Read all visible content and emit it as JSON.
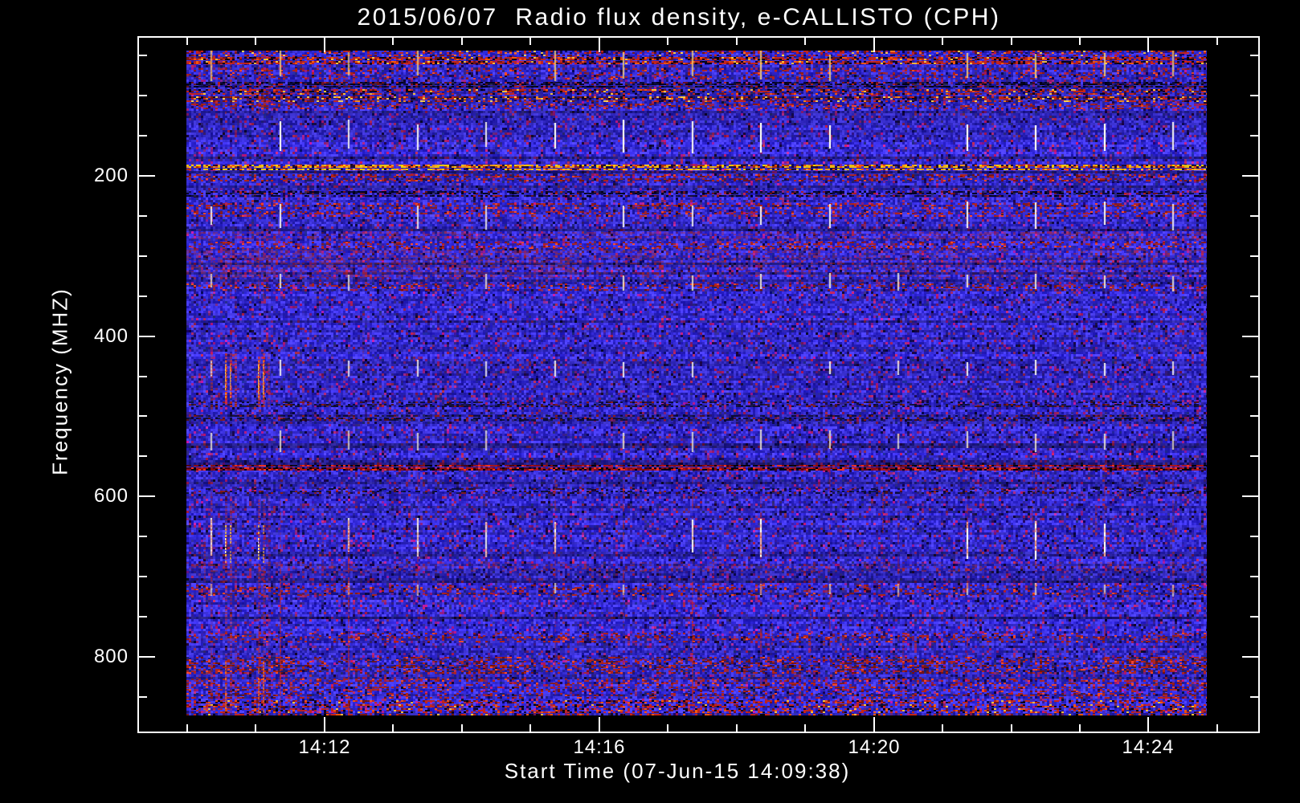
{
  "colors": {
    "background": "#000000",
    "text": "#ffffff",
    "frame": "#ffffff"
  },
  "chart_data": {
    "type": "heatmap",
    "variant": "radio-spectrogram",
    "title": "2015/06/07  Radio flux density, e-CALLISTO (CPH)",
    "xlabel": "Start Time (07-Jun-15 14:09:38)",
    "ylabel": "Frequency (MHZ)",
    "instrument": "e-CALLISTO (CPH)",
    "date": "2015/06/07",
    "start_time": "14:09:38",
    "x_axis": {
      "unit": "minutes-since-14:00",
      "range": [
        9.28,
        25.62
      ],
      "major_ticks": [
        {
          "value": 12,
          "label": "14:12"
        },
        {
          "value": 16,
          "label": "14:16"
        },
        {
          "value": 20,
          "label": "14:20"
        },
        {
          "value": 24,
          "label": "14:24"
        }
      ],
      "minor_tick_interval": 1
    },
    "y_axis": {
      "unit": "MHz",
      "range": [
        26,
        895
      ],
      "inverted": true,
      "major_ticks": [
        {
          "value": 200,
          "label": "200"
        },
        {
          "value": 400,
          "label": "400"
        },
        {
          "value": 600,
          "label": "600"
        },
        {
          "value": 800,
          "label": "800"
        }
      ],
      "minor_tick_interval": 50
    },
    "data_extent": {
      "time": [
        9.99,
        24.85
      ],
      "freq": [
        44,
        873
      ]
    },
    "background_noise": {
      "base_blue_low": "#1a1aa8",
      "base_blue_high": "#4a4aff",
      "dark_cell": "#05052e",
      "red_speckle": "#a02828",
      "dark_prob": 0.05,
      "red_speckle_prob": 0.08,
      "mid_blue_prob": 0.12
    },
    "palettes": {
      "rfi_mix": [
        [
          "#cc2410",
          0.3
        ],
        [
          "#ff7a1e",
          0.08
        ],
        [
          "#2a2ae0",
          0.25
        ],
        [
          "#0a0a50",
          0.17
        ],
        [
          "#ffd24a",
          0.05
        ],
        [
          "#7a1408",
          0.15
        ]
      ],
      "rfi_red": [
        [
          "#cc2410",
          0.4
        ],
        [
          "#ff5a00",
          0.12
        ],
        [
          "#ffc832",
          0.06
        ],
        [
          "#7a1408",
          0.18
        ],
        [
          "#0a0014",
          0.14
        ],
        [
          "#000000",
          0.1
        ]
      ],
      "rfi_yellow": [
        [
          "#cc2410",
          0.3
        ],
        [
          "#ff8c14",
          0.16
        ],
        [
          "#ffd24a",
          0.12
        ],
        [
          "#7a1408",
          0.2
        ],
        [
          "#140014",
          0.22
        ]
      ],
      "yellow_line": [
        [
          "#ffd200",
          0.3
        ],
        [
          "#ffa014",
          0.22
        ],
        [
          "#ff5000",
          0.14
        ],
        [
          "#b43200",
          0.12
        ],
        [
          "#1e0a28",
          0.22
        ]
      ],
      "dark": [
        [
          "#000010",
          0.45
        ],
        [
          "#0c0c3a",
          0.25
        ],
        [
          "#6e1010",
          0.12
        ],
        [
          "#b41e14",
          0.1
        ],
        [
          "#28284a",
          0.08
        ]
      ],
      "dark_faint": [
        [
          "#0a0a2e",
          0.5
        ],
        [
          "#14143c",
          0.2
        ],
        [
          "#501010",
          0.15
        ],
        [
          "#8c1a10",
          0.15
        ]
      ],
      "strong_line": [
        [
          "#8c0a0a",
          0.3
        ],
        [
          "#b41410",
          0.2
        ],
        [
          "#000000",
          0.28
        ],
        [
          "#ff3214",
          0.12
        ],
        [
          "#500000",
          0.1
        ]
      ],
      "red_sparse": [
        [
          "#b42314",
          0.55
        ],
        [
          "#8c1a0f",
          0.3
        ],
        [
          "#ff4b23",
          0.15
        ]
      ],
      "red_mottle": [
        [
          "#b42314",
          0.4
        ],
        [
          "#781208",
          0.25
        ],
        [
          "#ff4b23",
          0.1
        ],
        [
          "#1e1e64",
          0.25
        ]
      ],
      "red_haze": [
        [
          "#b4281e",
          1.0
        ]
      ]
    },
    "interference_bands": [
      {
        "freq": [
          44,
          51
        ],
        "type": "rfi_mix",
        "density": 0.5
      },
      {
        "freq": [
          52,
          60
        ],
        "type": "rfi_red",
        "density": 0.75
      },
      {
        "freq": [
          66,
          79
        ],
        "type": "red_sparse",
        "density": 0.2
      },
      {
        "freq": [
          83,
          90
        ],
        "type": "dark",
        "density": 0.7
      },
      {
        "freq": [
          92,
          99
        ],
        "type": "rfi_red",
        "density": 0.5
      },
      {
        "freq": [
          101,
          108
        ],
        "type": "rfi_yellow",
        "density": 0.55
      },
      {
        "freq": [
          110,
          117
        ],
        "type": "red_sparse",
        "density": 0.28
      },
      {
        "freq": [
          186,
          191
        ],
        "type": "yellow_line",
        "density": 0.8
      },
      {
        "freq": [
          198,
          206
        ],
        "type": "red_mottle",
        "density": 0.4
      },
      {
        "freq": [
          219,
          226
        ],
        "type": "dark",
        "density": 0.55
      },
      {
        "freq": [
          234,
          240
        ],
        "type": "red_sparse",
        "density": 0.3
      },
      {
        "freq": [
          244,
          250
        ],
        "type": "red_sparse",
        "density": 0.25
      },
      {
        "freq": [
          270,
          278
        ],
        "type": "red_haze",
        "density": 0.4
      },
      {
        "freq": [
          282,
          290
        ],
        "type": "red_sparse",
        "density": 0.25
      },
      {
        "freq": [
          292,
          328
        ],
        "type": "red_haze",
        "density": 0.32,
        "left_bias": true
      },
      {
        "freq": [
          334,
          342
        ],
        "type": "red_mottle",
        "density": 0.3
      },
      {
        "freq": [
          482,
          488
        ],
        "type": "dark_faint",
        "density": 0.4
      },
      {
        "freq": [
          499,
          505
        ],
        "type": "dark_faint",
        "density": 0.45
      },
      {
        "freq": [
          561,
          568
        ],
        "type": "strong_line",
        "density": 0.92
      },
      {
        "freq": [
          590,
          597
        ],
        "type": "dark_faint",
        "density": 0.3
      },
      {
        "freq": [
          682,
          694
        ],
        "type": "red_haze",
        "density": 0.22
      },
      {
        "freq": [
          710,
          724
        ],
        "type": "red_sparse",
        "density": 0.16
      },
      {
        "freq": [
          770,
          780
        ],
        "type": "red_sparse",
        "density": 0.22
      },
      {
        "freq": [
          800,
          820
        ],
        "type": "red_mottle",
        "density": 0.38,
        "cluster": true
      },
      {
        "freq": [
          827,
          838
        ],
        "type": "red_sparse",
        "density": 0.26
      },
      {
        "freq": [
          840,
          850
        ],
        "type": "red_mottle",
        "density": 0.28
      },
      {
        "freq": [
          854,
          872
        ],
        "type": "rfi_red",
        "density": 0.4
      }
    ],
    "calibration_streaks": {
      "first_minute": 10.35,
      "period_minutes": 1.0,
      "count": 15,
      "white_segments": [
        {
          "freq": [
            41,
            83
          ],
          "strength": 0.5,
          "color": "#ffd86e"
        },
        {
          "freq": [
            129,
            173
          ],
          "strength": 1.0,
          "color": "#f6f6f2"
        },
        {
          "freq": [
            231,
            268
          ],
          "strength": 0.75,
          "color": "#f6f6f2"
        },
        {
          "freq": [
            321,
            344
          ],
          "strength": 0.65,
          "color": "#f2ecd2"
        },
        {
          "freq": [
            429,
            452
          ],
          "strength": 0.7,
          "color": "#f6f6f2"
        },
        {
          "freq": [
            516,
            545
          ],
          "strength": 0.55,
          "color": "#f2ecd2"
        },
        {
          "freq": [
            626,
            679
          ],
          "strength": 1.0,
          "color": "#f6f6f2"
        },
        {
          "freq": [
            707,
            725
          ],
          "strength": 0.35,
          "color": "#f2ecd2"
        }
      ],
      "red_tail_freq": [
        560,
        873
      ]
    },
    "burst_streaks": [
      {
        "time": 10.35,
        "strength": 0.5
      },
      {
        "time": 10.56,
        "strength": 0.95
      },
      {
        "time": 10.63,
        "strength": 0.8
      },
      {
        "time": 10.7,
        "strength": 0.6
      },
      {
        "time": 11.03,
        "strength": 1.0
      },
      {
        "time": 11.1,
        "strength": 0.85
      },
      {
        "time": 11.17,
        "strength": 0.5
      }
    ]
  }
}
